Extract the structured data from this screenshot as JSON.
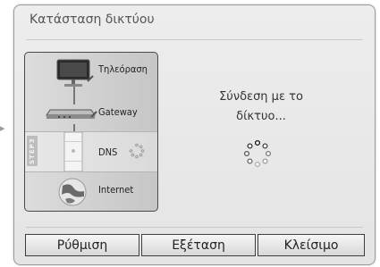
{
  "dialog": {
    "title": "Κατάσταση δικτύου"
  },
  "steps": [
    {
      "label": "Τηλεόραση",
      "icon": "tv-icon"
    },
    {
      "label": "Gateway",
      "icon": "router-icon"
    },
    {
      "label": "DNS",
      "icon": "server-icon",
      "tag": "STEP3",
      "active": true
    },
    {
      "label": "Internet",
      "icon": "globe-icon"
    }
  ],
  "status": {
    "line1": "Σύνδεση με το",
    "line2": "δίκτυο..."
  },
  "buttons": {
    "setup": "Ρύθμιση",
    "test": "Εξέταση",
    "close": "Κλείσιμο"
  },
  "colors": {
    "dialog_bg": "#e8e8e8",
    "panel_border": "#4a4a4a",
    "button_border": "#3e3e3e"
  }
}
